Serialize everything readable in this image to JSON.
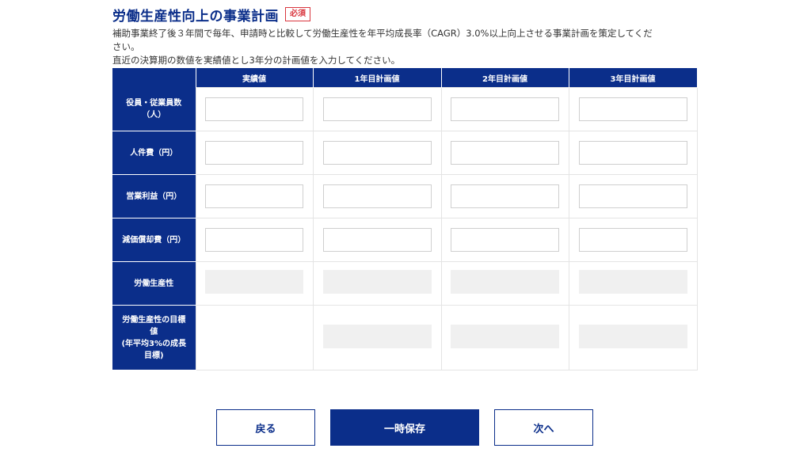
{
  "header": {
    "title": "労働生産性向上の事業計画",
    "required_badge": "必須",
    "desc_line1": "補助事業終了後３年間で毎年、申請時と比較して労働生産性を年平均成長率（CAGR）3.0%以上向上させる事業計画を策定してくだ",
    "desc_line2": "さい。",
    "desc_line3": "直近の決算期の数値を実績値とし3年分の計画値を入力してください。"
  },
  "table": {
    "columns": [
      "実績値",
      "1年目計画値",
      "2年目計画値",
      "3年目計画値"
    ],
    "rows": {
      "employees": {
        "label_1": "役員・従業員数",
        "label_2": "（人）",
        "values": [
          "",
          "",
          "",
          ""
        ]
      },
      "personnel_cost": {
        "label": "人件費（円）",
        "values": [
          "",
          "",
          "",
          ""
        ]
      },
      "operating_profit": {
        "label": "営業利益（円）",
        "values": [
          "",
          "",
          "",
          ""
        ]
      },
      "depreciation": {
        "label": "減価償却費（円）",
        "values": [
          "",
          "",
          "",
          ""
        ]
      },
      "productivity": {
        "label": "労働生産性"
      },
      "target": {
        "label_1": "労働生産性の目標",
        "label_2": "値",
        "label_3": "(年平均3%の成長",
        "label_4": "目標)"
      }
    }
  },
  "buttons": {
    "back": "戻る",
    "save": "一時保存",
    "next": "次へ"
  },
  "colors": {
    "primary": "#0b2e8a",
    "required": "#d9363e",
    "readonly_fill": "#f0f0f0"
  }
}
